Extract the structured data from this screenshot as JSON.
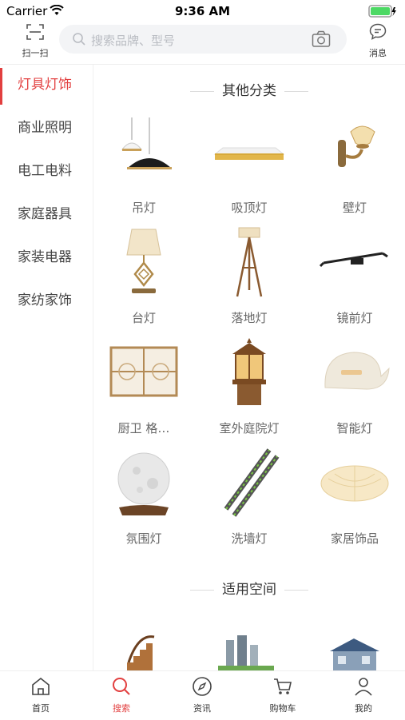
{
  "status_bar": {
    "carrier": "Carrier",
    "time": "9:36 AM"
  },
  "header": {
    "scan_label": "扫一扫",
    "search_placeholder": "搜索品牌、型号",
    "message_label": "消息"
  },
  "sidebar": {
    "items": [
      {
        "label": "灯具灯饰",
        "active": true
      },
      {
        "label": "商业照明",
        "active": false
      },
      {
        "label": "电工电料",
        "active": false
      },
      {
        "label": "家庭器具",
        "active": false
      },
      {
        "label": "家装电器",
        "active": false
      },
      {
        "label": "家纺家饰",
        "active": false
      }
    ]
  },
  "sections": {
    "other_categories_title": "其他分类",
    "spaces_title": "适用空间"
  },
  "categories": [
    {
      "name": "吊灯",
      "icon": "pendant-lamp-icon"
    },
    {
      "name": "吸顶灯",
      "icon": "ceiling-lamp-icon"
    },
    {
      "name": "壁灯",
      "icon": "wall-lamp-icon"
    },
    {
      "name": "台灯",
      "icon": "table-lamp-icon"
    },
    {
      "name": "落地灯",
      "icon": "floor-lamp-icon"
    },
    {
      "name": "镜前灯",
      "icon": "mirror-lamp-icon"
    },
    {
      "name": "厨卫 格…",
      "icon": "kitchen-bath-lamp-icon"
    },
    {
      "name": "室外庭院灯",
      "icon": "outdoor-garden-lamp-icon"
    },
    {
      "name": "智能灯",
      "icon": "smart-lamp-icon"
    },
    {
      "name": "氛围灯",
      "icon": "moon-lamp-icon"
    },
    {
      "name": "洗墙灯",
      "icon": "wall-washer-icon"
    },
    {
      "name": "家居饰品",
      "icon": "home-decor-lamp-icon"
    }
  ],
  "spaces": [
    {
      "icon": "staircase-space-icon"
    },
    {
      "icon": "building-space-icon"
    },
    {
      "icon": "house-space-icon"
    }
  ],
  "tabbar": {
    "items": [
      {
        "label": "首页",
        "icon": "home-icon",
        "active": false
      },
      {
        "label": "搜索",
        "icon": "search-icon",
        "active": true
      },
      {
        "label": "资讯",
        "icon": "compass-icon",
        "active": false
      },
      {
        "label": "购物车",
        "icon": "cart-icon",
        "active": false
      },
      {
        "label": "我的",
        "icon": "user-icon",
        "active": false
      }
    ]
  },
  "colors": {
    "accent": "#e23f3f",
    "text": "#333333",
    "muted": "#666666",
    "search_bg": "#f3f4f6"
  }
}
